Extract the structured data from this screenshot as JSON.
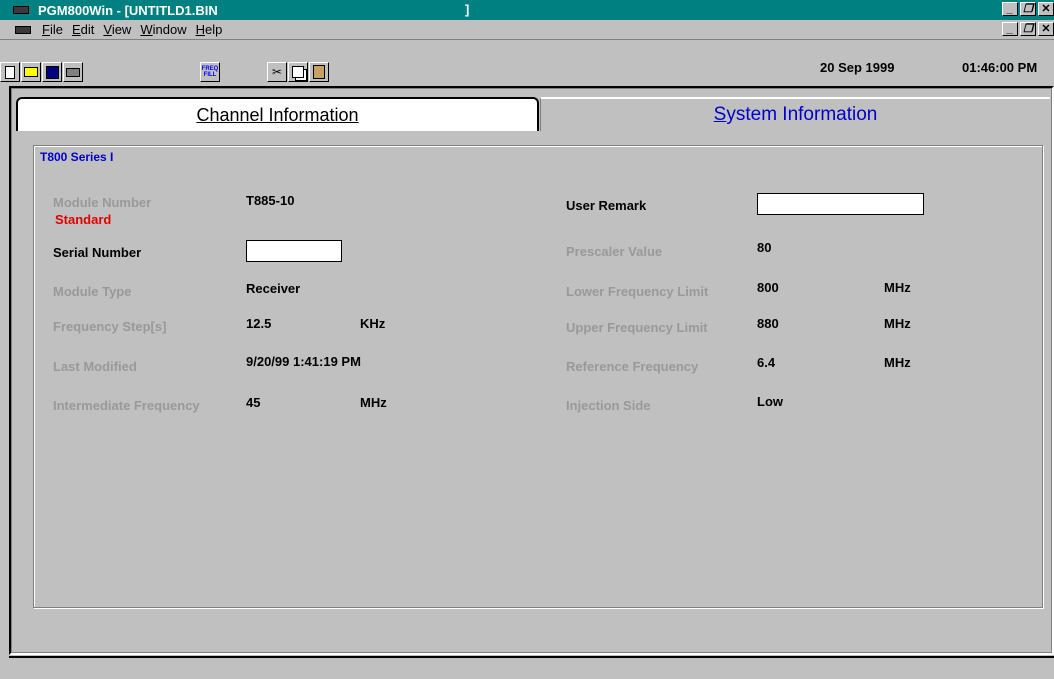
{
  "titlebar": {
    "title": "PGM800Win - [UNTITLD1.BIN",
    "bracket": "]",
    "min_icon": "_",
    "restore_icon": "🗗",
    "close_icon": "✕"
  },
  "menu": {
    "items": [
      {
        "accel": "F",
        "rest": "ile"
      },
      {
        "accel": "E",
        "rest": "dit"
      },
      {
        "accel": "V",
        "rest": "iew"
      },
      {
        "accel": "W",
        "rest": "indow"
      },
      {
        "accel": "H",
        "rest": "elp"
      }
    ]
  },
  "toolbar": {
    "date": "20 Sep 1999",
    "time": "01:46:00 PM",
    "freq_fill_line1": "FREQ",
    "freq_fill_line2": "FILL"
  },
  "tabs": {
    "channel": {
      "accel": "C",
      "rest": "hannel Information"
    },
    "system": {
      "accel": "S",
      "rest": "ystem Information"
    }
  },
  "group": {
    "title": "T800 Series I"
  },
  "fields": {
    "module_number_label": "Module Number",
    "module_number_value": "T885-10",
    "module_standard": "Standard",
    "serial_number_label": "Serial Number",
    "serial_number_value": "",
    "module_type_label": "Module Type",
    "module_type_value": "Receiver",
    "freq_step_label": "Frequency Step[s]",
    "freq_step_value": "12.5",
    "freq_step_unit": "KHz",
    "last_modified_label": "Last Modified",
    "last_modified_value": "9/20/99 1:41:19 PM",
    "intermediate_freq_label": "Intermediate Frequency",
    "intermediate_freq_value": "45",
    "intermediate_freq_unit": "MHz",
    "user_remark_label": "User Remark",
    "user_remark_value": "",
    "prescaler_label": "Prescaler Value",
    "prescaler_value": "80",
    "lower_freq_label": "Lower Frequency Limit",
    "lower_freq_value": "800",
    "lower_freq_unit": "MHz",
    "upper_freq_label": "Upper Frequency Limit",
    "upper_freq_value": "880",
    "upper_freq_unit": "MHz",
    "ref_freq_label": "Reference Frequency",
    "ref_freq_value": "6.4",
    "ref_freq_unit": "MHz",
    "injection_label": "Injection Side",
    "injection_value": "Low"
  }
}
